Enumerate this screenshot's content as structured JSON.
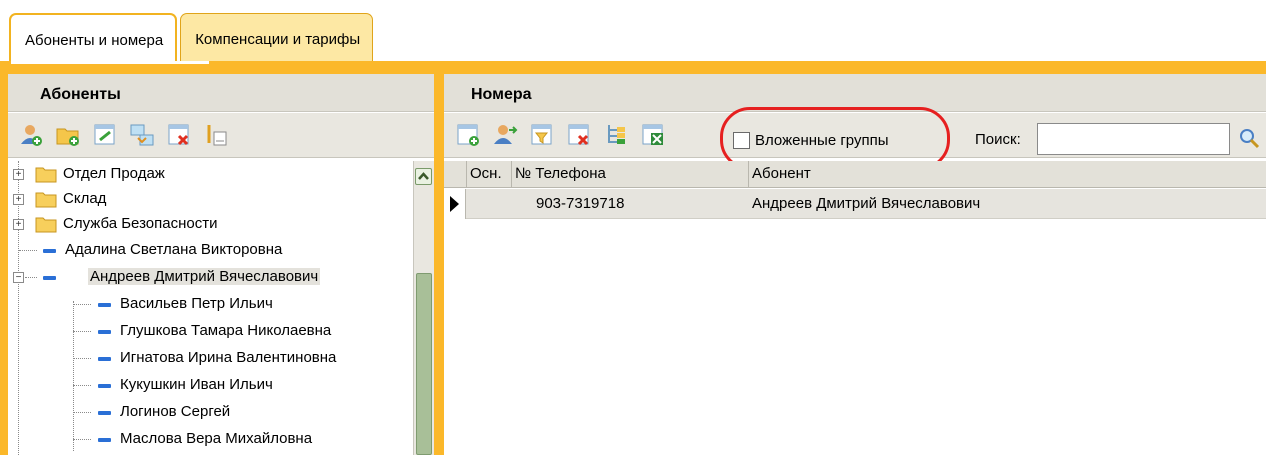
{
  "tabs": [
    {
      "label": "Абоненты и номера",
      "active": true
    },
    {
      "label": "Компенсации и тарифы",
      "active": false
    }
  ],
  "left_panel": {
    "title": "Абоненты",
    "toolbar_icons": [
      "add-subscriber-icon",
      "add-folder-icon",
      "edit-icon",
      "move-icon",
      "delete-icon",
      "sort-icon"
    ],
    "tree": [
      {
        "label": "Отдел Продаж",
        "type": "folder",
        "expander": "+"
      },
      {
        "label": "Склад",
        "type": "folder",
        "expander": "+"
      },
      {
        "label": "Служба Безопасности",
        "type": "folder",
        "expander": "+"
      },
      {
        "label": "Адалина Светлана Викторовна",
        "type": "person"
      },
      {
        "label": "Андреев Дмитрий Вячеславович",
        "type": "person",
        "expander": "−",
        "selected": true
      },
      {
        "label": "Васильев Петр Ильич",
        "type": "person",
        "child": true
      },
      {
        "label": "Глушкова Тамара Николаевна",
        "type": "person",
        "child": true
      },
      {
        "label": "Игнатова Ирина Валентиновна",
        "type": "person",
        "child": true
      },
      {
        "label": "Кукушкин Иван Ильич",
        "type": "person",
        "child": true
      },
      {
        "label": "Логинов Сергей",
        "type": "person",
        "child": true
      },
      {
        "label": "Маслова Вера Михайловна",
        "type": "person",
        "child": true
      }
    ]
  },
  "right_panel": {
    "title": "Номера",
    "toolbar_icons": [
      "add-number-icon",
      "assign-icon",
      "filter-icon",
      "delete-icon",
      "tree-icon",
      "export-excel-icon"
    ],
    "nested_groups_label": "Вложенные группы",
    "nested_groups_checked": false,
    "search_label": "Поиск:",
    "search_value": "",
    "columns": [
      "Осн.",
      "№ Телефона",
      "Абонент"
    ],
    "rows": [
      {
        "main": "",
        "phone": "903-7319718",
        "subscriber": "Андреев Дмитрий Вячеславович"
      }
    ]
  },
  "colors": {
    "accent": "#fbb82a",
    "highlight": "#e62020",
    "person_icon": "#2a6fd6"
  }
}
